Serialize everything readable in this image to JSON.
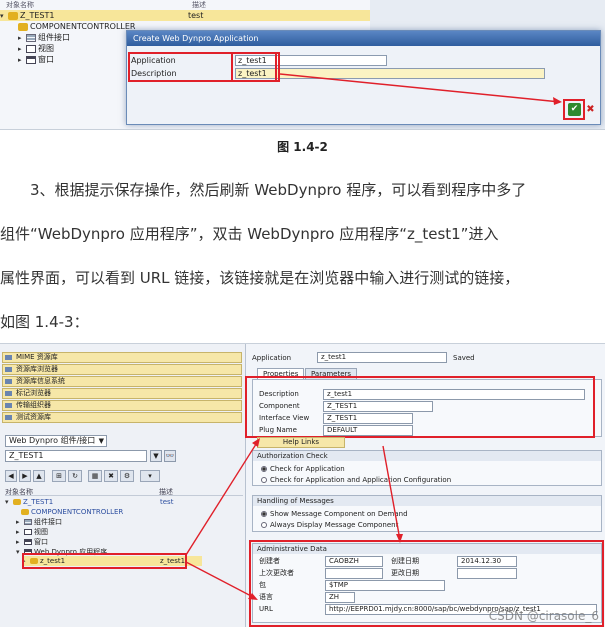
{
  "screenshot1": {
    "tree_header": {
      "col1": "对象名称",
      "col2": "描述"
    },
    "tree": [
      {
        "label": "Z_TEST1",
        "desc": "test"
      },
      {
        "label": "COMPONENTCONTROLLER"
      },
      {
        "label": "组件接口"
      },
      {
        "label": "视图"
      },
      {
        "label": "窗口"
      }
    ],
    "dialog": {
      "title": "Create Web Dynpro Application",
      "application_label": "Application",
      "application_value": "z_test1",
      "description_label": "Description",
      "description_value": "z_test1"
    }
  },
  "caption1": "图 1.4-2",
  "paragraph": [
    "3、根据提示保存操作，然后刷新 WebDynpro 程序，可以看到程序中多了",
    "组件“WebDynpro 应用程序”，双击 WebDynpro 应用程序“z_test1”进入",
    "属性界面，可以看到 URL 链接，该链接就是在浏览器中输入进行测试的链接，",
    "如图 1.4-3："
  ],
  "screenshot2": {
    "nav_items": [
      "MIME 资源库",
      "资源库浏览器",
      "资源库信息系统",
      "标记浏览器",
      "传输组织器",
      "测试资源库"
    ],
    "object_type": "Web Dynpro 组件/接口",
    "object_name": "Z_TEST1",
    "tree_header": {
      "col1": "对象名称",
      "col2": "描述"
    },
    "tree": [
      {
        "label": "Z_TEST1",
        "desc": "test"
      },
      {
        "label": "COMPONENTCONTROLLER"
      },
      {
        "label": "组件接口"
      },
      {
        "label": "视图"
      },
      {
        "label": "窗口"
      },
      {
        "label": "Web Dynpro 应用程序"
      },
      {
        "label": "z_test1",
        "desc": "z_test1"
      }
    ],
    "application_label": "Application",
    "application_value": "z_test1",
    "status": "Saved",
    "tabs": [
      "Properties",
      "Parameters"
    ],
    "props": [
      {
        "label": "Description",
        "value": "z_test1"
      },
      {
        "label": "Component",
        "value": "Z_TEST1"
      },
      {
        "label": "Interface View",
        "value": "Z_TEST1"
      },
      {
        "label": "Plug Name",
        "value": "DEFAULT"
      }
    ],
    "help_links": "Help Links",
    "auth_title": "Authorization Check",
    "auth_options": [
      "Check for Application",
      "Check for Application and Application Configuration"
    ],
    "msg_title": "Handling of Messages",
    "msg_options": [
      "Show Message Component on Demand",
      "Always Display Message Component"
    ],
    "admin_title": "Administrative Data",
    "admin": {
      "created_by_label": "创建者",
      "created_by": "CAOBZH",
      "created_on_label": "创建日期",
      "created_on": "2014.12.30",
      "changed_by_label": "上次更改者",
      "changed_on_label": "更改日期",
      "package_label": "包",
      "package": "$TMP",
      "language_label": "语言",
      "language": "ZH",
      "url_label": "URL",
      "url": "http://EEPRD01.mjdy.cn:8000/sap/bc/webdynpro/sap/z_test1"
    },
    "watermark": "CSDN @cirasole_6"
  }
}
